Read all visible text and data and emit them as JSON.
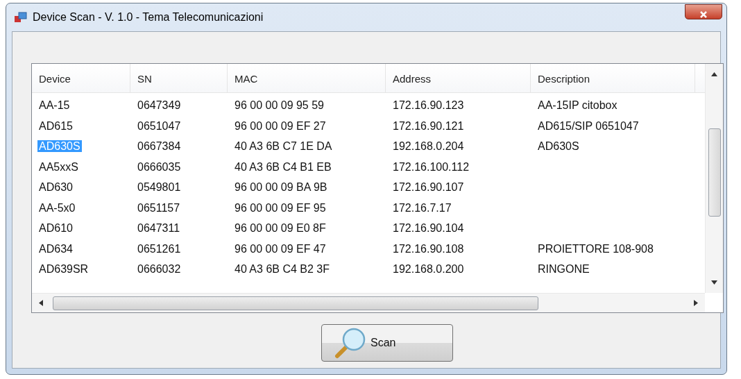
{
  "window": {
    "title": "Device Scan - V. 1.0  - Tema Telecomunicazioni"
  },
  "table": {
    "columns": [
      "Device",
      "SN",
      "MAC",
      "Address",
      "Description"
    ],
    "rows": [
      {
        "cells": [
          "AA-15",
          "0647349",
          "96 00 00 09 95 59",
          "172.16.90.123",
          "AA-15IP citobox"
        ],
        "selected": false
      },
      {
        "cells": [
          "AD615",
          "0651047",
          "96 00 00 09 EF 27",
          "172.16.90.121",
          "AD615/SIP 0651047"
        ],
        "selected": false
      },
      {
        "cells": [
          "AD630S",
          "0667384",
          "40 A3 6B C7 1E DA",
          "192.168.0.204",
          "AD630S"
        ],
        "selected": true
      },
      {
        "cells": [
          "AA5xxS",
          "0666035",
          "40 A3 6B C4 B1 EB",
          "172.16.100.112",
          ""
        ],
        "selected": false
      },
      {
        "cells": [
          "AD630",
          "0549801",
          "96 00 00 09 BA 9B",
          "172.16.90.107",
          ""
        ],
        "selected": false
      },
      {
        "cells": [
          "AA-5x0",
          "0651157",
          "96 00 00 09 EF 95",
          "172.16.7.17",
          ""
        ],
        "selected": false
      },
      {
        "cells": [
          "AD610",
          "0647311",
          "96 00 00 09 E0 8F",
          "172.16.90.104",
          ""
        ],
        "selected": false
      },
      {
        "cells": [
          "AD634",
          "0651261",
          "96 00 00 09 EF 47",
          "172.16.90.108",
          "PROIETTORE 108-908"
        ],
        "selected": false
      },
      {
        "cells": [
          "AD639SR",
          "0666032",
          "40 A3 6B C4 B2 3F",
          "192.168.0.200",
          "RINGONE"
        ],
        "selected": false
      }
    ]
  },
  "buttons": [
    {
      "label": "Scan"
    }
  ]
}
